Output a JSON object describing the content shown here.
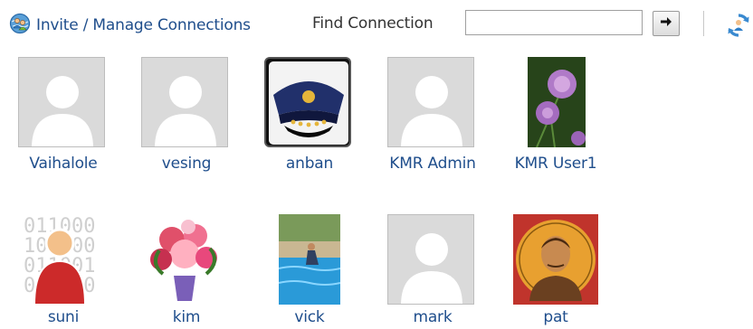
{
  "toolbar": {
    "invite_label": "Invite / Manage Connections",
    "find_label": "Find Connection",
    "find_value": "",
    "icons": {
      "invite": "people-globe-icon",
      "go": "arrow-right-icon",
      "refresh": "refresh-icon"
    }
  },
  "connections": [
    {
      "name": "Vaihalole",
      "avatar": "default-person"
    },
    {
      "name": "vesing",
      "avatar": "default-person"
    },
    {
      "name": "anban",
      "avatar": "captain-hat"
    },
    {
      "name": "KMR Admin",
      "avatar": "default-person"
    },
    {
      "name": "KMR User1",
      "avatar": "flower-photo"
    },
    {
      "name": "suni",
      "avatar": "binary-user"
    },
    {
      "name": "kim",
      "avatar": "bouquet-photo"
    },
    {
      "name": "vick",
      "avatar": "pool-photo"
    },
    {
      "name": "mark",
      "avatar": "default-person"
    },
    {
      "name": "pat",
      "avatar": "portrait-photo"
    }
  ]
}
